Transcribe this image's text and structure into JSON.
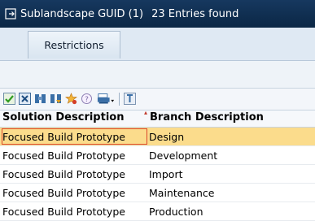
{
  "window": {
    "title": "Sublandscape GUID (1)",
    "entries_found": "23 Entries found"
  },
  "tabs": [
    {
      "label": "Restrictions"
    }
  ],
  "toolbar": {
    "icons": [
      "check-icon",
      "cancel-icon",
      "find-icon",
      "find-next-icon",
      "star-settings-icon",
      "help-icon",
      "print-icon",
      "pin-icon"
    ]
  },
  "table": {
    "columns": [
      "Solution Description",
      "Branch Description"
    ],
    "rows": [
      {
        "solution": "Focused Build Prototype",
        "branch": "Design",
        "selected": true
      },
      {
        "solution": "Focused Build Prototype",
        "branch": "Development",
        "selected": false
      },
      {
        "solution": "Focused Build Prototype",
        "branch": "Import",
        "selected": false
      },
      {
        "solution": "Focused Build Prototype",
        "branch": "Maintenance",
        "selected": false
      },
      {
        "solution": "Focused Build Prototype",
        "branch": "Production",
        "selected": false
      }
    ]
  },
  "colors": {
    "titlebar": "#16385f",
    "selected_row": "#fbdc8c",
    "focus_border": "#d9472b"
  }
}
